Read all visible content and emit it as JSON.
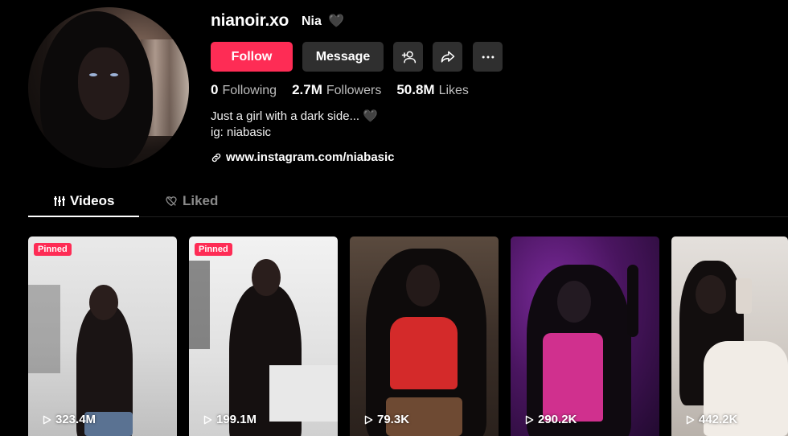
{
  "profile": {
    "username": "nianoir.xo",
    "nickname": "Nia",
    "nickname_suffix": "🖤",
    "buttons": {
      "follow": "Follow",
      "message": "Message"
    },
    "stats": [
      {
        "value": "0",
        "label": "Following"
      },
      {
        "value": "2.7M",
        "label": "Followers"
      },
      {
        "value": "50.8M",
        "label": "Likes"
      }
    ],
    "bio_line1": "Just a girl with a dark side...",
    "bio_heart": "🖤",
    "bio_line2": "ig: niabasic",
    "link": "www.instagram.com/niabasic"
  },
  "tabs": {
    "videos": "Videos",
    "liked": "Liked"
  },
  "videos": [
    {
      "views": "323.4M",
      "badge": "Pinned"
    },
    {
      "views": "199.1M",
      "badge": "Pinned"
    },
    {
      "views": "79.3K"
    },
    {
      "views": "290.2K"
    },
    {
      "views": "442.2K"
    }
  ],
  "colors": {
    "accent": "#fe2c55",
    "button_bg": "#2f2f2f",
    "background": "#000000"
  }
}
